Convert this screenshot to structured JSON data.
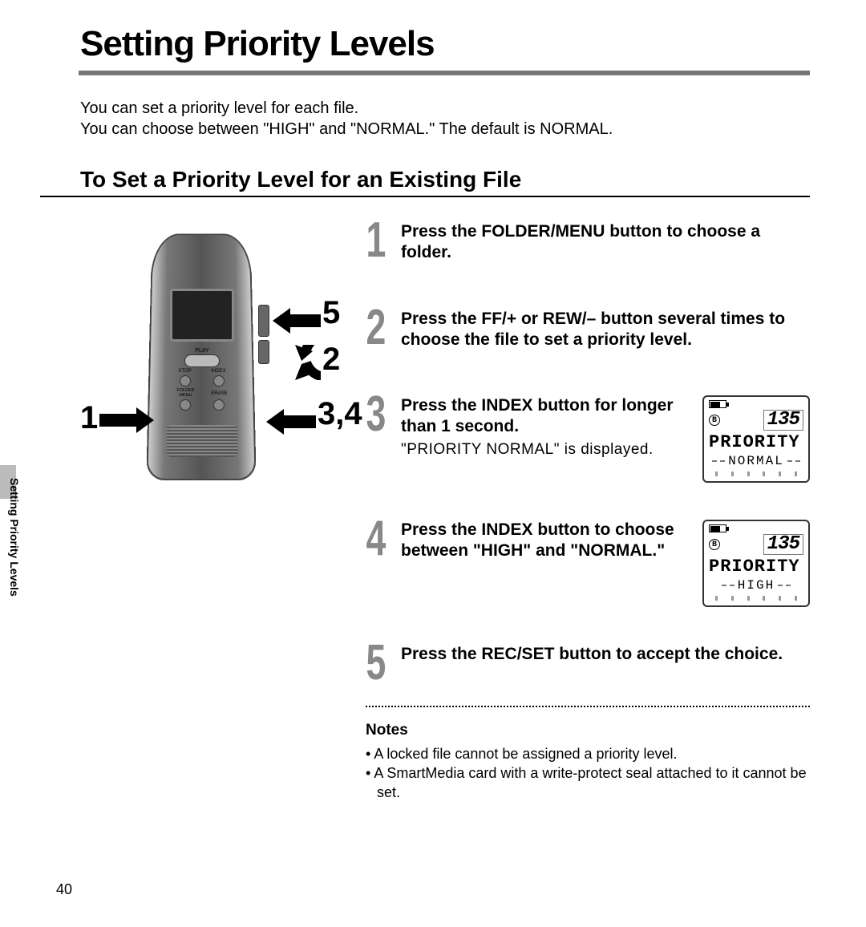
{
  "title": "Setting Priority Levels",
  "intro_line1": "You can set a priority level for each file.",
  "intro_line2": "You can choose between \"HIGH\" and \"NORMAL.\"  The default is NORMAL.",
  "subtitle": "To Set a Priority Level for an Existing File",
  "device": {
    "buttons": {
      "play": "PLAY",
      "stop": "STOP",
      "index": "INDEX",
      "folder_menu": "FOLDER\nMENU",
      "erase": "ERASE"
    },
    "callouts": {
      "left": "1",
      "top_right": "5",
      "mid_right": "2",
      "bottom_right": "3,4"
    }
  },
  "steps": [
    {
      "num": "1",
      "title": "Press the FOLDER/MENU button to choose a folder."
    },
    {
      "num": "2",
      "title": "Press the FF/+ or REW/– button several times to choose the file to set a priority level."
    },
    {
      "num": "3",
      "title": "Press the INDEX button for longer than 1 second.",
      "sub": "\"PRIORITY NORMAL\" is displayed.",
      "lcd": {
        "folder": "B",
        "file": "135",
        "line1": "PRIORITY",
        "status": "NORMAL"
      }
    },
    {
      "num": "4",
      "title": "Press the INDEX button to choose between \"HIGH\" and \"NORMAL.\"",
      "lcd": {
        "folder": "B",
        "file": "135",
        "line1": "PRIORITY",
        "status": "HIGH"
      }
    },
    {
      "num": "5",
      "title": "Press the REC/SET button to accept the choice."
    }
  ],
  "notes": {
    "heading": "Notes",
    "items": [
      "A locked file cannot be assigned a priority level.",
      "A SmartMedia card with a write-protect seal attached to it cannot be set."
    ]
  },
  "side_tab": "Setting Priority Levels",
  "page_number": "40"
}
